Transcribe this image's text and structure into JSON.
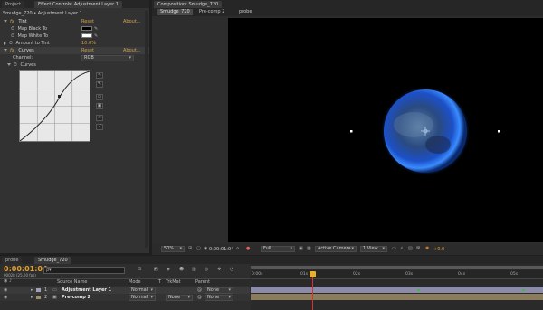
{
  "left_panel": {
    "tabs": [
      {
        "label": "Project",
        "active": false
      },
      {
        "label": "Effect Controls: Adjustment Layer 1",
        "active": true
      }
    ],
    "breadcrumb": "Smudge_720 • Adjustment Layer 1",
    "tint": {
      "name": "Tint",
      "reset": "Reset",
      "about": "About...",
      "map_black_label": "Map Black To",
      "map_white_label": "Map White To",
      "amount_label": "Amount to Tint",
      "amount_value": "10.0%"
    },
    "curves": {
      "name": "Curves",
      "reset": "Reset",
      "about": "About...",
      "channel_label": "Channel:",
      "channel_value": "RGB",
      "curves_label": "Curves"
    },
    "colors": {
      "black": "#000000",
      "white": "#ffffff"
    }
  },
  "comp_panel": {
    "title": "Composition: Smudge_720",
    "nav": [
      "Smudge_720",
      "Pre-comp 2",
      "probe"
    ],
    "footer": {
      "zoom": "50%",
      "timecode": "0:00:01:04",
      "resolution": "Full",
      "view": "Active Camera",
      "views": "1 View",
      "exposure": "+0.0"
    }
  },
  "timeline": {
    "tabs": [
      {
        "label": "probe",
        "active": false
      },
      {
        "label": "Smudge_720",
        "active": true
      }
    ],
    "timecode": "0:00:01:04",
    "subtime": "00028 (25.00 fps)",
    "search_placeholder": "ρ▾",
    "columns": {
      "source": "Source Name",
      "mode": "Mode",
      "t": "T",
      "trkmat": "TrkMat",
      "parent": "Parent"
    },
    "layers": [
      {
        "num": "1",
        "name": "Adjustment Layer 1",
        "mode": "Normal",
        "trkmat": "",
        "parent": "None",
        "color": "#a0a0b8"
      },
      {
        "num": "2",
        "name": "Pre-comp 2",
        "mode": "Normal",
        "trkmat": "None",
        "parent": "None",
        "color": "#a09070"
      }
    ],
    "ruler": [
      "0:00s",
      "01s",
      "02s",
      "03s",
      "04s",
      "05s"
    ]
  }
}
